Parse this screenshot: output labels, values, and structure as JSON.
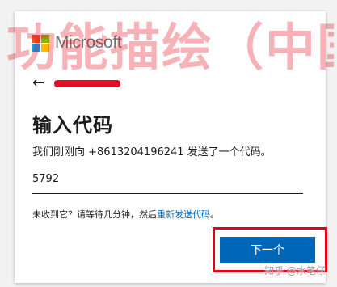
{
  "brand": {
    "name": "Microsoft",
    "logo_colors": [
      "#f25022",
      "#7fba00",
      "#00a4ef",
      "#ffb900"
    ]
  },
  "back": {
    "icon": "back-arrow-icon",
    "glyph": "←"
  },
  "page": {
    "title": "输入代码",
    "description": "我们刚刚向 +8613204196241 发送了一个代码。"
  },
  "code_field": {
    "value": "5792"
  },
  "hint": {
    "prefix": "未收到它？请等待几分钟，然后",
    "link": "重新发送代码",
    "suffix": "。"
  },
  "next_button": {
    "label": "下一个"
  },
  "overlay": {
    "text": "功能描绘（中国）官网"
  },
  "site_watermark": "知乎 @水笔仔",
  "colors": {
    "accent": "#0067b8",
    "highlight": "#e60012"
  }
}
